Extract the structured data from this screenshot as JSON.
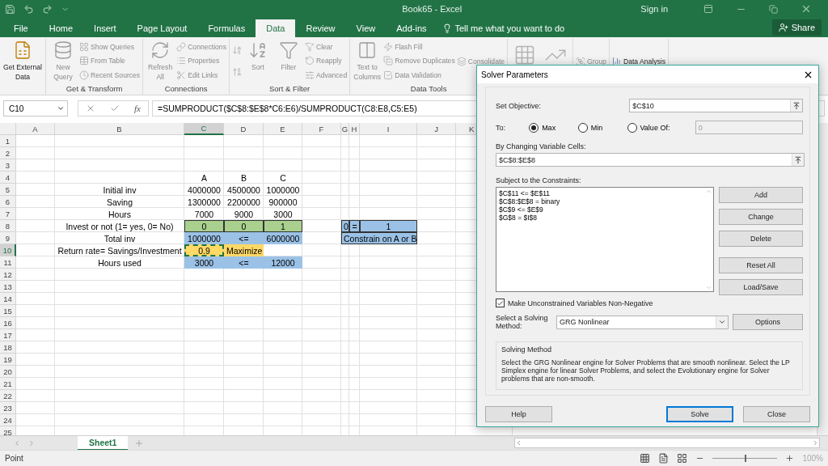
{
  "window": {
    "title": "Book65  -  Excel",
    "sign_in": "Sign in"
  },
  "tabs": [
    {
      "label": "File",
      "selected": false
    },
    {
      "label": "Home",
      "selected": false
    },
    {
      "label": "Insert",
      "selected": false
    },
    {
      "label": "Page Layout",
      "selected": false
    },
    {
      "label": "Formulas",
      "selected": false
    },
    {
      "label": "Data",
      "selected": true
    },
    {
      "label": "Review",
      "selected": false
    },
    {
      "label": "View",
      "selected": false
    },
    {
      "label": "Add-ins",
      "selected": false
    }
  ],
  "tell_me": "Tell me what you want to do",
  "share": "Share",
  "ribbon": {
    "groups": [
      {
        "items": [
          {
            "label": "Get External Data",
            "kind": "large",
            "disabled": false
          }
        ]
      },
      {
        "label": "Get & Transform",
        "items": [
          {
            "label": "New Query",
            "kind": "large",
            "disabled": true
          },
          {
            "label": "Show Queries",
            "kind": "small",
            "disabled": true
          },
          {
            "label": "From Table",
            "kind": "small",
            "disabled": true
          },
          {
            "label": "Recent Sources",
            "kind": "small",
            "disabled": true
          }
        ]
      },
      {
        "label": "Connections",
        "items": [
          {
            "label": "Refresh All",
            "kind": "large",
            "disabled": true
          },
          {
            "label": "Connections",
            "kind": "small",
            "disabled": true
          },
          {
            "label": "Properties",
            "kind": "small",
            "disabled": true
          },
          {
            "label": "Edit Links",
            "kind": "small",
            "disabled": true
          }
        ]
      },
      {
        "label": "Sort & Filter",
        "items": [
          {
            "kind": "icon",
            "disabled": true
          },
          {
            "kind": "icon",
            "disabled": true
          },
          {
            "label": "Sort",
            "kind": "large",
            "disabled": true
          },
          {
            "label": "Filter",
            "kind": "large",
            "disabled": true
          },
          {
            "label": "Clear",
            "kind": "small",
            "disabled": true
          },
          {
            "label": "Reapply",
            "kind": "small",
            "disabled": true
          },
          {
            "label": "Advanced",
            "kind": "small",
            "disabled": true
          }
        ]
      },
      {
        "label": "Data Tools",
        "items": [
          {
            "label": "Text to Columns",
            "kind": "large",
            "disabled": true
          },
          {
            "label": "Flash Fill",
            "kind": "small",
            "disabled": true
          },
          {
            "label": "Remove Duplicates",
            "kind": "small",
            "disabled": true
          },
          {
            "label": "Data Validation",
            "kind": "small",
            "disabled": true
          },
          {
            "label": "Consolidate",
            "kind": "small",
            "disabled": true
          }
        ]
      },
      {
        "items": [
          {
            "kind": "bigicon",
            "disabled": true
          },
          {
            "kind": "bigicon",
            "disabled": true
          }
        ]
      },
      {
        "items": [
          {
            "label": "Group",
            "kind": "small",
            "disabled": true
          }
        ]
      },
      {
        "items": [
          {
            "label": "Data Analysis",
            "kind": "small",
            "disabled": false
          }
        ]
      }
    ]
  },
  "formula_bar": {
    "name_box": "C10",
    "fx": "fx",
    "formula": "=SUMPRODUCT($C$8:$E$8*C6:E6)/SUMPRODUCT(C8:E8,C5:E5)"
  },
  "sheet": {
    "columns": [
      {
        "label": "A",
        "selected": false
      },
      {
        "label": "B",
        "selected": false
      },
      {
        "label": "C",
        "selected": true
      },
      {
        "label": "D",
        "selected": false
      },
      {
        "label": "E",
        "selected": false
      },
      {
        "label": "F",
        "selected": false
      },
      {
        "label": "G",
        "selected": false
      },
      {
        "label": "H",
        "selected": false
      },
      {
        "label": "I",
        "selected": false
      },
      {
        "label": "J",
        "selected": false
      },
      {
        "label": "K",
        "selected": false
      }
    ],
    "rows": [
      {
        "number": "1",
        "selected": false
      },
      {
        "number": "2",
        "selected": false
      },
      {
        "number": "3",
        "selected": false
      },
      {
        "number": "4",
        "selected": false,
        "cells": [
          null,
          null,
          {
            "text": "A",
            "selected": false
          },
          {
            "text": "B",
            "selected": false
          },
          {
            "text": "C",
            "selected": false
          },
          null,
          null,
          null,
          null,
          null,
          null
        ]
      },
      {
        "number": "5",
        "selected": false,
        "cells": [
          null,
          {
            "text": "Initial inv",
            "selected": false
          },
          {
            "text": "4000000",
            "selected": false
          },
          {
            "text": "4500000",
            "selected": false
          },
          {
            "text": "1000000",
            "selected": false
          },
          null,
          null,
          null,
          null,
          null,
          null
        ]
      },
      {
        "number": "6",
        "selected": false,
        "cells": [
          null,
          {
            "text": "Saving",
            "selected": false
          },
          {
            "text": "1300000",
            "selected": false
          },
          {
            "text": "2200000",
            "selected": false
          },
          {
            "text": "900000",
            "selected": false
          },
          null,
          null,
          null,
          null,
          null,
          null
        ]
      },
      {
        "number": "7",
        "selected": false,
        "cells": [
          null,
          {
            "text": "Hours",
            "selected": false
          },
          {
            "text": "7000",
            "selected": false
          },
          {
            "text": "9000",
            "selected": false
          },
          {
            "text": "3000",
            "selected": false
          },
          null,
          null,
          null,
          null,
          null,
          null
        ]
      },
      {
        "number": "8",
        "selected": false,
        "cells": [
          null,
          {
            "text": "Invest or not (1= yes, 0= No)",
            "selected": false
          },
          {
            "text": "0",
            "color": "#a9d08e",
            "bordered": true,
            "selected": false
          },
          {
            "text": "0",
            "color": "#a9d08e",
            "bordered": true,
            "selected": false
          },
          {
            "text": "1",
            "color": "#a9d08e",
            "bordered": true,
            "selected": false
          },
          null,
          {
            "text": "0",
            "color": "#9bc2e6",
            "bordered": true,
            "selected": false,
            "left_aligned": true
          },
          {
            "text": "=",
            "color": "#9bc2e6",
            "bordered": true,
            "selected": false
          },
          {
            "text": "1",
            "color": "#9bc2e6",
            "bordered": true,
            "selected": false
          },
          null,
          null
        ]
      },
      {
        "number": "9",
        "selected": false,
        "cells": [
          null,
          {
            "text": "Total inv",
            "selected": false
          },
          {
            "text": "1000000",
            "color": "#9bc2e6",
            "bordered": false,
            "selected": false
          },
          {
            "text": "<=",
            "color": "#9bc2e6",
            "bordered": false,
            "selected": false
          },
          {
            "text": "6000000",
            "color": "#9bc2e6",
            "bordered": false,
            "selected": false
          },
          null,
          {
            "text": "Constrain on A or B",
            "color": "#9bc2e6",
            "bordered": true,
            "selected": false,
            "left_aligned": true
          },
          {
            "merged": true
          },
          {
            "merged": true
          },
          null,
          null
        ]
      },
      {
        "number": "10",
        "selected": true,
        "cells": [
          null,
          {
            "text": "Return rate= Savings/Investment",
            "selected": false
          },
          {
            "text": "0.9",
            "color": "#ffd966",
            "bordered": false,
            "selected": true
          },
          {
            "text": "Maximize",
            "color": "#ffd966",
            "bordered": false,
            "selected": false,
            "left_aligned": true
          },
          null,
          null,
          null,
          null,
          null,
          null,
          null
        ]
      },
      {
        "number": "11",
        "selected": false,
        "cells": [
          null,
          {
            "text": "Hours used",
            "selected": false
          },
          {
            "text": "3000",
            "color": "#9bc2e6",
            "bordered": false,
            "selected": false
          },
          {
            "text": "<=",
            "color": "#9bc2e6",
            "bordered": false,
            "selected": false
          },
          {
            "text": "12000",
            "color": "#9bc2e6",
            "bordered": false,
            "selected": false
          },
          null,
          null,
          null,
          null,
          null,
          null
        ]
      },
      {
        "number": "12",
        "selected": false
      },
      {
        "number": "13",
        "selected": false
      },
      {
        "number": "14",
        "selected": false
      },
      {
        "number": "15",
        "selected": false
      },
      {
        "number": "16",
        "selected": false
      },
      {
        "number": "17",
        "selected": false
      },
      {
        "number": "18",
        "selected": false
      },
      {
        "number": "19",
        "selected": false
      },
      {
        "number": "20",
        "selected": false
      },
      {
        "number": "21",
        "selected": false
      },
      {
        "number": "22",
        "selected": false
      },
      {
        "number": "23",
        "selected": false
      },
      {
        "number": "24",
        "selected": false
      },
      {
        "number": "25",
        "selected": false
      }
    ]
  },
  "sheet_tabs": [
    {
      "label": "Sheet1",
      "selected": true
    }
  ],
  "status_bar": {
    "mode": "Point",
    "zoom": {
      "level": 0.5,
      "reading": "100%"
    }
  },
  "dialog": {
    "title": "Solver Parameters",
    "objective": {
      "label": "Set Objective:",
      "value": "$C$10"
    },
    "to": {
      "label": "To:",
      "options": [
        {
          "label": "Max",
          "selected": true
        },
        {
          "label": "Min",
          "selected": false
        },
        {
          "label": "Value Of:",
          "selected": false
        }
      ],
      "value_field": {
        "value": "0",
        "disabled": true
      }
    },
    "changing": {
      "label": "By Changing Variable Cells:",
      "value": "$C$8:$E$8"
    },
    "constraints": {
      "label": "Subject to the Constraints:",
      "items": [
        "$C$11 <= $E$11",
        "$C$8:$E$8 = binary",
        "$C$9 <= $E$9",
        "$G$8 = $I$8"
      ]
    },
    "side_buttons": [
      [
        "Add",
        "Change",
        "Delete"
      ],
      [
        "Reset All",
        "Load/Save"
      ]
    ],
    "nonnegative": {
      "label": "Make Unconstrained Variables Non-Negative",
      "checked": true
    },
    "method": {
      "label": "Select a Solving Method:",
      "value": "GRG Nonlinear"
    },
    "options_button": "Options",
    "description": {
      "title": "Solving Method",
      "text": "Select the GRG Nonlinear engine for Solver Problems that are smooth nonlinear. Select the LP Simplex engine for linear Solver Problems, and select the Evolutionary engine for Solver problems that are non-smooth."
    },
    "footer_buttons": [
      {
        "label": "Help",
        "default": false
      },
      {
        "label": "Solve",
        "default": true
      },
      {
        "label": "Close",
        "default": false
      }
    ]
  }
}
